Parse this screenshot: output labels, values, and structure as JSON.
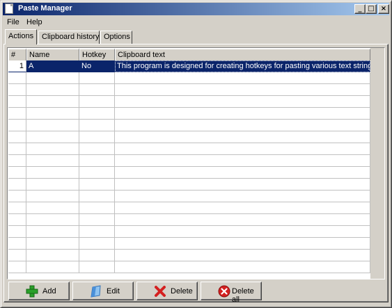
{
  "window": {
    "title": "Paste Manager",
    "buttons": {
      "minimize": "_",
      "maximize": "□",
      "close": "×"
    }
  },
  "menu": {
    "items": [
      "File",
      "Help"
    ]
  },
  "tabs": [
    {
      "label": "Actions",
      "active": true
    },
    {
      "label": "Clipboard history",
      "active": false
    },
    {
      "label": "Options",
      "active": false
    }
  ],
  "grid": {
    "columns": [
      "#",
      "Name",
      "Hotkey",
      "Clipboard text"
    ],
    "rows": [
      {
        "num": "1",
        "name": "A",
        "hotkey": "No",
        "text": "This program is designed for creating hotkeys for pasting various text strings...",
        "selected": true
      }
    ]
  },
  "buttons": [
    {
      "label": "Add",
      "icon": "add-icon",
      "color": "#2aa02a"
    },
    {
      "label": "Edit",
      "icon": "edit-icon",
      "color": "#4a90d9"
    },
    {
      "label": "Delete",
      "icon": "delete-icon",
      "color": "#d42020"
    },
    {
      "label": "Delete all",
      "icon": "delete-all-icon",
      "color": "#d42020"
    }
  ],
  "colors": {
    "selection": "#0a246a",
    "face": "#d4d0c8"
  }
}
